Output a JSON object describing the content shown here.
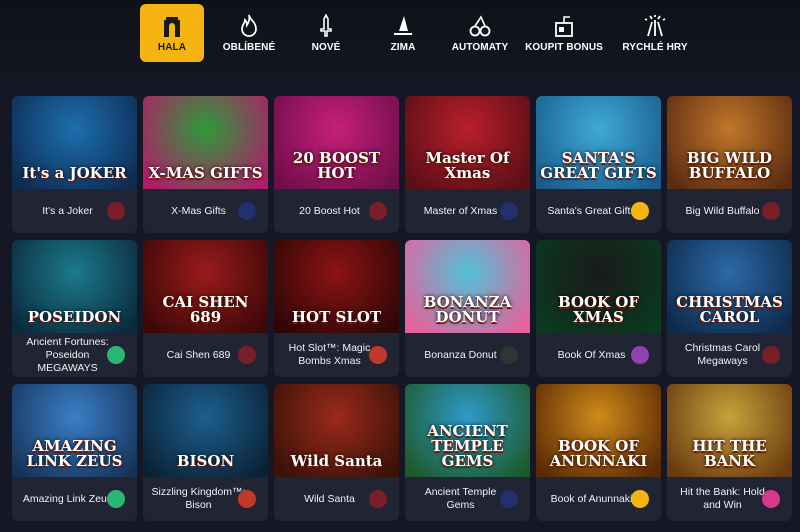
{
  "nav": [
    {
      "label": "HALA",
      "icon": "arch-icon",
      "active": true
    },
    {
      "label": "OBLÍBENÉ",
      "icon": "flame-icon",
      "active": false
    },
    {
      "label": "NOVÉ",
      "icon": "sword-icon",
      "active": false
    },
    {
      "label": "ZIMA",
      "icon": "witch-hat-icon",
      "active": false
    },
    {
      "label": "AUTOMATY",
      "icon": "cherries-icon",
      "active": false
    },
    {
      "label": "KOUPIT BONUS",
      "icon": "bonus-box-icon",
      "active": false
    },
    {
      "label": "RYCHLÉ HRY",
      "icon": "fireworks-icon",
      "active": false
    }
  ],
  "games": [
    {
      "name": "It's a Joker",
      "art": "It's a JOKER",
      "bg1": "#1d6fb0",
      "bg2": "#0d2c52",
      "provider_color": "#7a1f2a"
    },
    {
      "name": "X-Mas Gifts",
      "art": "X-MAS GIFTS",
      "bg1": "#2e9a3a",
      "bg2": "#b01c6a",
      "provider_color": "#22306e"
    },
    {
      "name": "20 Boost Hot",
      "art": "20 BOOST HOT",
      "bg1": "#c61f7a",
      "bg2": "#6e0f4a",
      "provider_color": "#7a1f2a"
    },
    {
      "name": "Master of Xmas",
      "art": "Master Of Xmas",
      "bg1": "#b8202b",
      "bg2": "#5a0e16",
      "provider_color": "#22306e"
    },
    {
      "name": "Santa's Great Gifts",
      "art": "SANTA'S GREAT GIFTS",
      "bg1": "#3fa9d8",
      "bg2": "#1a5d8c",
      "provider_color": "#f5b412"
    },
    {
      "name": "Big Wild Buffalo",
      "art": "BIG WILD BUFFALO",
      "bg1": "#c2762b",
      "bg2": "#5a2c10",
      "provider_color": "#7a1f2a"
    },
    {
      "name": "Ancient Fortunes: Poseidon MEGAWAYS",
      "art": "POSEIDON",
      "bg1": "#1b7a8c",
      "bg2": "#0b2a3c",
      "provider_color": "#2bb673"
    },
    {
      "name": "Cai Shen 689",
      "art": "CAI SHEN 689",
      "bg1": "#9a1b1b",
      "bg2": "#3c0808",
      "provider_color": "#7a1f2a"
    },
    {
      "name": "Hot Slot™: Magic Bombs Xmas",
      "art": "HOT SLOT",
      "bg1": "#8c1414",
      "bg2": "#2e0606",
      "provider_color": "#c0392b"
    },
    {
      "name": "Bonanza Donut",
      "art": "BONANZA DONUT",
      "bg1": "#4fc3d9",
      "bg2": "#e8609a",
      "provider_color": "#333333"
    },
    {
      "name": "Book Of Xmas",
      "art": "BOOK OF XMAS",
      "bg1": "#1a1a1a",
      "bg2": "#0a3a20",
      "provider_color": "#8e44ad"
    },
    {
      "name": "Christmas Carol Megaways",
      "art": "CHRISTMAS CAROL",
      "bg1": "#2b6aa8",
      "bg2": "#0e2a4a",
      "provider_color": "#7a1f2a"
    },
    {
      "name": "Amazing Link Zeus",
      "art": "AMAZING LINK ZEUS",
      "bg1": "#3a7fc8",
      "bg2": "#16345a",
      "provider_color": "#2bb673"
    },
    {
      "name": "Sizzling Kingdom™: Bison",
      "art": "BISON",
      "bg1": "#1c5f8e",
      "bg2": "#0b2236",
      "provider_color": "#c0392b"
    },
    {
      "name": "Wild Santa",
      "art": "Wild Santa",
      "bg1": "#9a2a1a",
      "bg2": "#3a1208",
      "provider_color": "#7a1f2a"
    },
    {
      "name": "Ancient Temple Gems",
      "art": "ANCIENT TEMPLE GEMS",
      "bg1": "#2e9acb",
      "bg2": "#1d5a2a",
      "provider_color": "#22306e"
    },
    {
      "name": "Book of Anunnaki",
      "art": "BOOK OF ANUNNAKI",
      "bg1": "#d08a1a",
      "bg2": "#5a2a06",
      "provider_color": "#f5b412"
    },
    {
      "name": "Hit the Bank: Hold and Win",
      "art": "HIT THE BANK",
      "bg1": "#c8a23a",
      "bg2": "#6a3a10",
      "provider_color": "#d63a8a"
    }
  ]
}
